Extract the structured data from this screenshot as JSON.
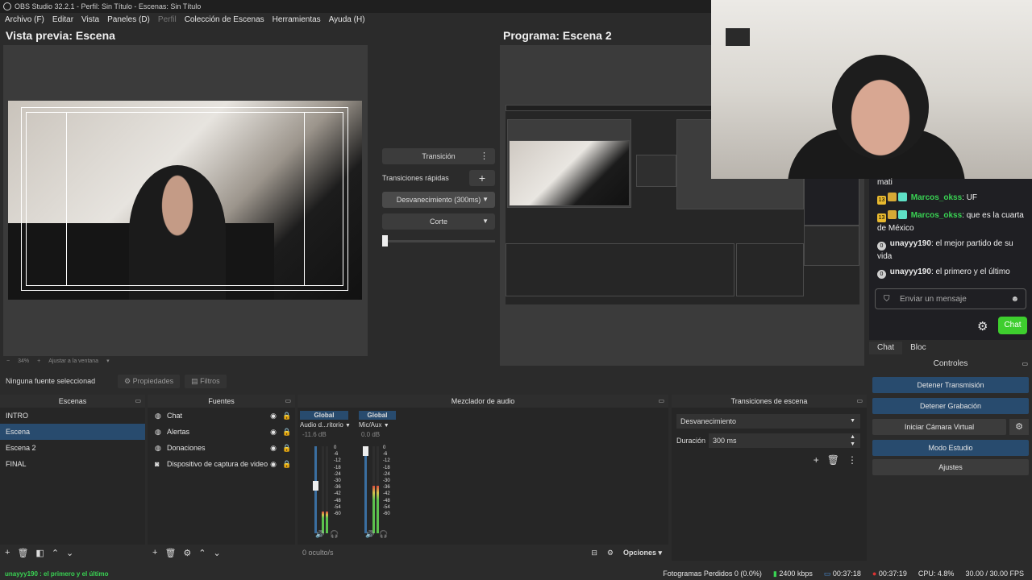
{
  "window": {
    "title": "OBS Studio 32.2.1 - Perfil: Sin Título - Escenas: Sin Título"
  },
  "menu": {
    "items": [
      {
        "label": "Archivo (F)",
        "enabled": true
      },
      {
        "label": "Editar",
        "enabled": true
      },
      {
        "label": "Vista",
        "enabled": true
      },
      {
        "label": "Paneles (D)",
        "enabled": true
      },
      {
        "label": "Perfil",
        "enabled": false
      },
      {
        "label": "Colección de Escenas",
        "enabled": true
      },
      {
        "label": "Herramientas",
        "enabled": true
      },
      {
        "label": "Ayuda (H)",
        "enabled": true
      }
    ]
  },
  "preview": {
    "title": "Vista previa: Escena",
    "zoom": "34%",
    "fit": "Ajustar a la ventana"
  },
  "program": {
    "title": "Programa: Escena 2"
  },
  "transition": {
    "button": "Transición",
    "quick_label": "Transiciones rápidas",
    "fade": "Desvanecimiento (300ms)",
    "cut": "Corte",
    "slider_value": 0
  },
  "chat": {
    "messages": [
      {
        "user": "",
        "text": "mati",
        "badges": []
      },
      {
        "user": "Marcos_okss",
        "text": ": UF",
        "badges": [
          "13",
          "crown",
          "bits"
        ]
      },
      {
        "user": "Marcos_okss",
        "text": ": que es la cuarta de México",
        "badges": [
          "13",
          "crown",
          "bits"
        ]
      },
      {
        "user": "unayyy190",
        "text": ": el mejor partido de su vida",
        "badges": [
          "0"
        ]
      },
      {
        "user": "unayyy190",
        "text": ": el primero y el último",
        "badges": [
          "0"
        ]
      }
    ],
    "input_placeholder": "Enviar un mensaje",
    "chat_button": "Chat",
    "tabs": [
      "Chat",
      "Bloc"
    ]
  },
  "controls": {
    "title": "Controles",
    "stop_stream": "Detener Transmisión",
    "stop_record": "Detener Grabación",
    "virtual_cam": "Iniciar Cámara Virtual",
    "studio_mode": "Modo Estudio",
    "settings": "Ajustes"
  },
  "source_bar": {
    "no_selection": "Ninguna fuente seleccionad",
    "properties": "Propiedades",
    "filters": "Filtros"
  },
  "scenes": {
    "title": "Escenas",
    "items": [
      "INTRO",
      "Escena",
      "Escena 2",
      "FINAL"
    ],
    "selected": "Escena"
  },
  "sources": {
    "title": "Fuentes",
    "items": [
      {
        "name": "Chat",
        "icon": "globe-icon"
      },
      {
        "name": "Alertas",
        "icon": "globe-icon"
      },
      {
        "name": "Donaciones",
        "icon": "globe-icon"
      },
      {
        "name": "Dispositivo de captura de video",
        "icon": "camera-icon"
      }
    ]
  },
  "mixer": {
    "title": "Mezclador de audio",
    "channels": [
      {
        "tag": "Global",
        "name": "Audio d...ritorio",
        "db": "-11.6 dB",
        "level": 0.25,
        "volume": 0.55
      },
      {
        "tag": "Global",
        "name": "Mic/Aux",
        "db": "0.0 dB",
        "level": 0.55,
        "volume": 1.0
      }
    ],
    "ticks": [
      "0",
      "-6",
      "-12",
      "-18",
      "-24",
      "-30",
      "-36",
      "-42",
      "-48",
      "-54",
      "-60"
    ],
    "hidden_label": "0 oculto/s",
    "options": "Opciones"
  },
  "scene_transitions": {
    "title": "Transiciones de escena",
    "selected": "Desvanecimiento",
    "duration_label": "Duración",
    "duration_value": "300 ms"
  },
  "status": {
    "chatline": "unayyy190 : el primero y el último",
    "dropped": "Fotogramas Perdidos 0 (0.0%)",
    "bitrate": "2400 kbps",
    "stream_time": "00:37:18",
    "rec_time": "00:37:19",
    "cpu": "CPU: 4.8%",
    "fps": "30.00 / 30.00 FPS"
  }
}
